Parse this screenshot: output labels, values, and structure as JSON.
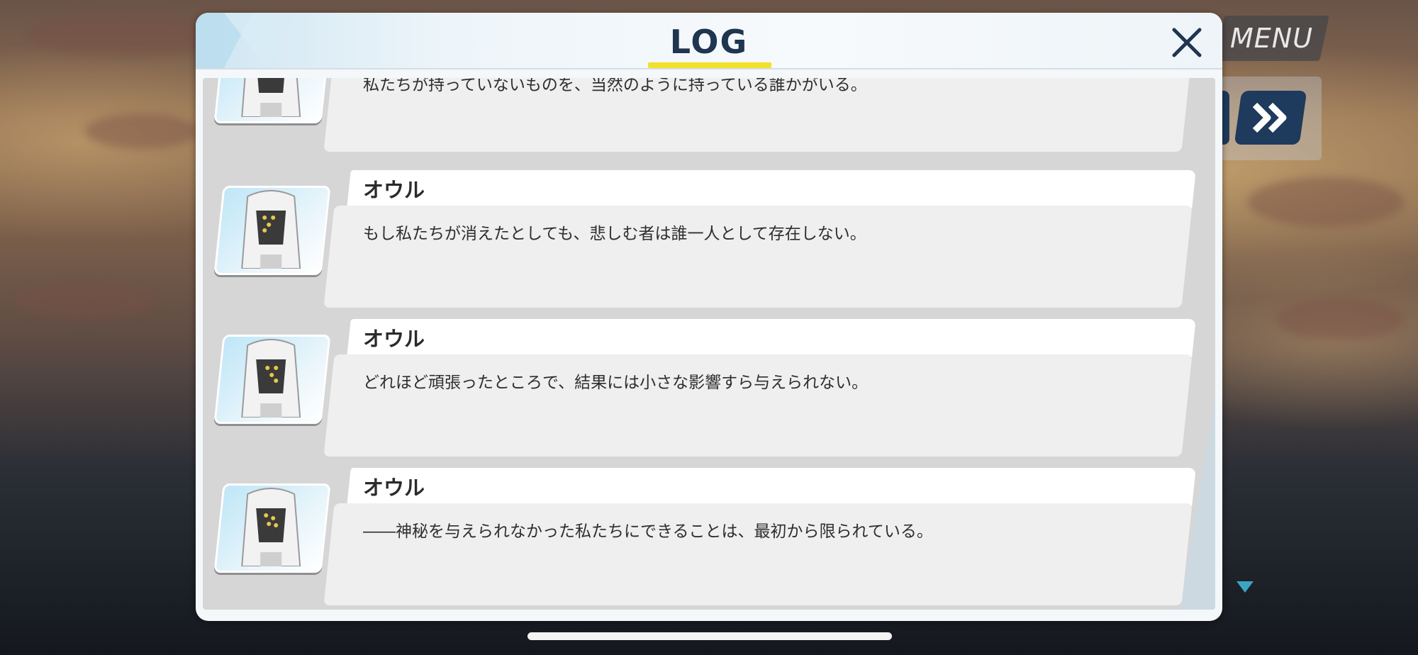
{
  "log": {
    "title": "LOG",
    "entries": [
      {
        "speaker": "",
        "text": "私たちが持っていないものを、当然のように持っている誰かがいる。"
      },
      {
        "speaker": "オウル",
        "text": "もし私たちが消えたとしても、悲しむ者は誰一人として存在しない。"
      },
      {
        "speaker": "オウル",
        "text": "どれほど頑張ったところで、結果には小さな影響すら与えられない。"
      },
      {
        "speaker": "オウル",
        "text": "――神秘を与えられなかった私たちにできることは、最初から限られている。"
      }
    ]
  },
  "hud": {
    "menu_label": "MENU",
    "fast_forward_icon": "double-chevron-right-icon",
    "next_icon": "triangle-down-icon"
  },
  "colors": {
    "title": "#1f3550",
    "underline": "#f2e12a",
    "hud_button": "#1e3a5c"
  }
}
